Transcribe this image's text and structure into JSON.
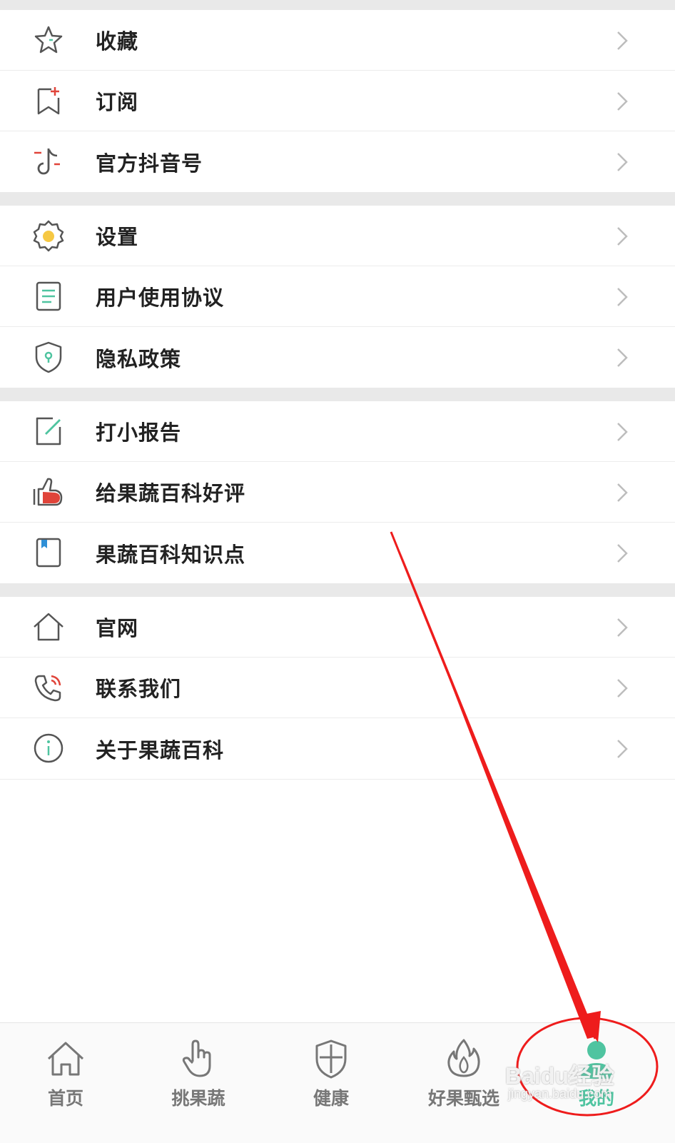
{
  "menu": {
    "group1": [
      {
        "label": "收藏",
        "icon": "star-icon"
      },
      {
        "label": "订阅",
        "icon": "bookmark-add-icon"
      },
      {
        "label": "官方抖音号",
        "icon": "tiktok-icon"
      }
    ],
    "group2": [
      {
        "label": "设置",
        "icon": "gear-icon"
      },
      {
        "label": "用户使用协议",
        "icon": "document-icon"
      },
      {
        "label": "隐私政策",
        "icon": "shield-icon"
      }
    ],
    "group3": [
      {
        "label": "打小报告",
        "icon": "edit-icon"
      },
      {
        "label": "给果蔬百科好评",
        "icon": "thumbs-up-icon"
      },
      {
        "label": "果蔬百科知识点",
        "icon": "notebook-icon"
      }
    ],
    "group4": [
      {
        "label": "官网",
        "icon": "home-icon"
      },
      {
        "label": "联系我们",
        "icon": "phone-icon"
      },
      {
        "label": "关于果蔬百科",
        "icon": "info-icon"
      }
    ]
  },
  "bottom_nav": [
    {
      "label": "首页",
      "icon": "home-icon",
      "active": false
    },
    {
      "label": "挑果蔬",
      "icon": "hand-pointer-icon",
      "active": false
    },
    {
      "label": "健康",
      "icon": "shield-icon",
      "active": false
    },
    {
      "label": "好果甄选",
      "icon": "flame-icon",
      "active": false
    },
    {
      "label": "我的",
      "icon": "user-icon",
      "active": true
    }
  ],
  "watermark": {
    "line1": "Baidu经验",
    "line2": "jingyan.baidu.com"
  },
  "colors": {
    "accent": "#4fc4a0",
    "annotation": "#ee1c1c",
    "icon_stroke": "#555555",
    "icon_red": "#e0443a"
  }
}
